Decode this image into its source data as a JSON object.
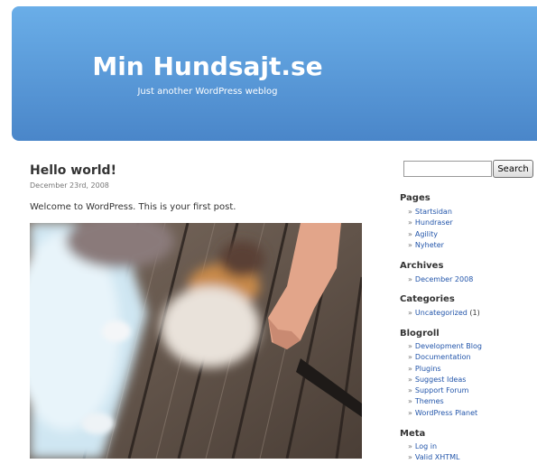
{
  "header": {
    "title": "Min Hundsajt.se",
    "tagline": "Just another WordPress weblog",
    "gradient_top": "#6aaee8",
    "gradient_bottom": "#4a86c9"
  },
  "post": {
    "title": "Hello world!",
    "date": "December 23rd, 2008",
    "body": "Welcome to WordPress. This is your first post."
  },
  "search": {
    "value": "",
    "button_label": "Search"
  },
  "sidebar": {
    "arrow": "»",
    "pages": {
      "heading": "Pages",
      "items": [
        "Startsidan",
        "Hundraser",
        "Agility",
        "Nyheter"
      ]
    },
    "archives": {
      "heading": "Archives",
      "items": [
        "December 2008"
      ]
    },
    "categories": {
      "heading": "Categories",
      "items": [
        {
          "label": "Uncategorized",
          "count": "(1)"
        }
      ]
    },
    "blogroll": {
      "heading": "Blogroll",
      "items": [
        "Development Blog",
        "Documentation",
        "Plugins",
        "Suggest Ideas",
        "Support Forum",
        "Themes",
        "WordPress Planet"
      ]
    },
    "meta": {
      "heading": "Meta",
      "items": [
        "Log in",
        "Valid XHTML"
      ]
    }
  },
  "colors": {
    "link": "#2255aa",
    "text": "#333333"
  }
}
